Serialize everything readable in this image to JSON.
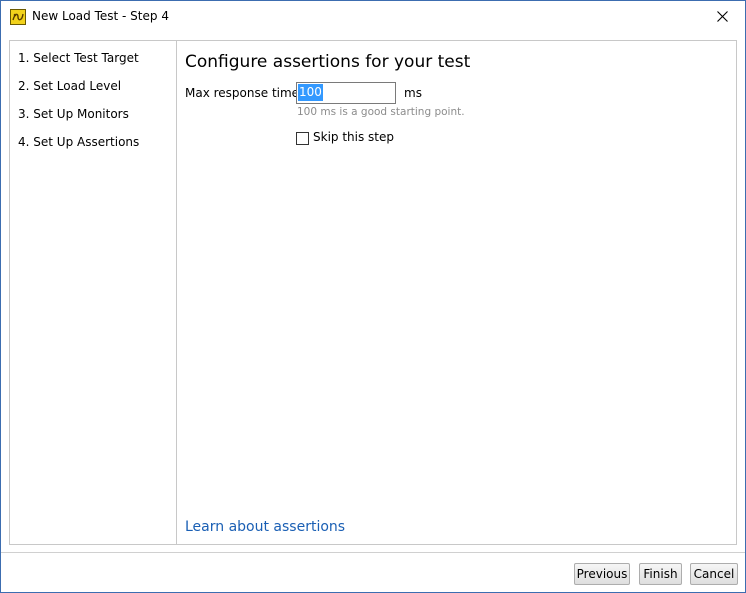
{
  "window": {
    "title": "New Load Test - Step 4"
  },
  "sidebar": {
    "steps": [
      {
        "label": "1. Select Test Target"
      },
      {
        "label": "2. Set Load Level"
      },
      {
        "label": "3. Set Up Monitors"
      },
      {
        "label": "4. Set Up Assertions"
      }
    ]
  },
  "main": {
    "heading": "Configure assertions for your test",
    "max_response": {
      "label": "Max response time:",
      "value": "100",
      "unit": "ms",
      "hint": "100 ms is a good starting point."
    },
    "skip": {
      "label": "Skip this step",
      "checked": false
    },
    "learn_link": "Learn about assertions"
  },
  "footer": {
    "previous_label": "Previous",
    "finish_label": "Finish",
    "cancel_label": "Cancel"
  },
  "colors": {
    "link": "#1a5fb4",
    "selection": "#3399ff",
    "app_icon": "#f2d21b"
  }
}
